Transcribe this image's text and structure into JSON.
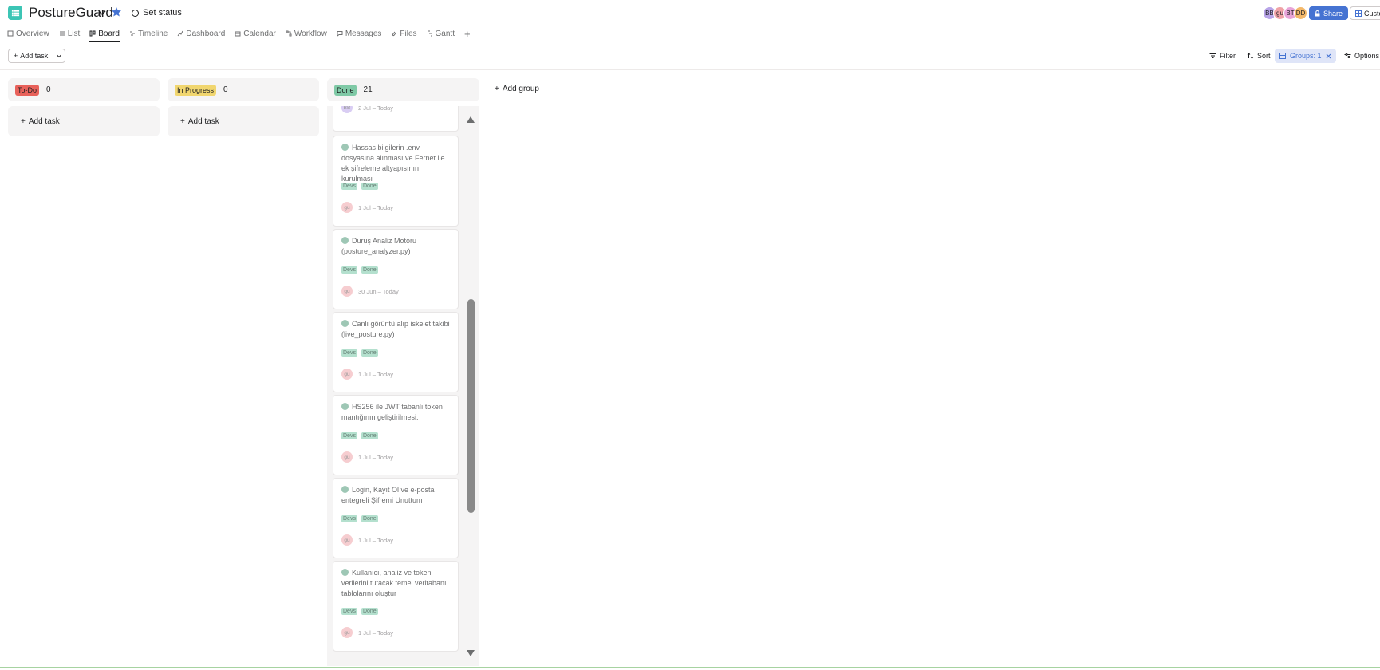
{
  "header": {
    "project_title": "PostureGuard",
    "set_status": "Set status",
    "avatars": [
      {
        "initials": "BB",
        "color": "#b8a4e8"
      },
      {
        "initials": "gu",
        "color": "#f0a2a6"
      },
      {
        "initials": "BT",
        "color": "#e8a4d8"
      },
      {
        "initials": "DD",
        "color": "#f4b96b"
      }
    ],
    "share_label": "Share",
    "customize_label": "Custom"
  },
  "tabs": [
    {
      "label": "Overview",
      "icon": "overview-icon"
    },
    {
      "label": "List",
      "icon": "list-icon"
    },
    {
      "label": "Board",
      "icon": "board-icon",
      "active": true
    },
    {
      "label": "Timeline",
      "icon": "timeline-icon"
    },
    {
      "label": "Dashboard",
      "icon": "dashboard-icon"
    },
    {
      "label": "Calendar",
      "icon": "calendar-icon"
    },
    {
      "label": "Workflow",
      "icon": "workflow-icon"
    },
    {
      "label": "Messages",
      "icon": "messages-icon"
    },
    {
      "label": "Files",
      "icon": "files-icon"
    },
    {
      "label": "Gantt",
      "icon": "gantt-icon"
    }
  ],
  "toolbar": {
    "add_task_label": "Add task",
    "filter_label": "Filter",
    "sort_label": "Sort",
    "groups_label": "Groups: 1",
    "options_label": "Options"
  },
  "columns": [
    {
      "name": "To-Do",
      "count": "0",
      "pill_color": "#e8615a",
      "add_task": "Add task"
    },
    {
      "name": "In Progress",
      "count": "0",
      "pill_color": "#f1d66f",
      "add_task": "Add task"
    },
    {
      "name": "Done",
      "count": "21",
      "pill_color": "#7fc9a6"
    }
  ],
  "cards": [
    {
      "title": "",
      "tags": [],
      "assignee": "BB",
      "assignee_color": "#c9b8ee",
      "dates": "2 Jul – Today"
    },
    {
      "title": "Hassas bilgilerin .env dosyasına alınması ve Fernet ile ek şifreleme altyapısının kurulması",
      "tags": [
        "Devs",
        "Done"
      ],
      "assignee": "gu",
      "assignee_color": "#f3b9bd",
      "dates": "1 Jul – Today"
    },
    {
      "title": "Duruş Analiz Motoru (posture_analyzer.py)",
      "tags": [
        "Devs",
        "Done"
      ],
      "assignee": "gu",
      "assignee_color": "#f3b9bd",
      "dates": "30 Jun – Today"
    },
    {
      "title": "Canlı görüntü alıp iskelet takibi (live_posture.py)",
      "tags": [
        "Devs",
        "Done"
      ],
      "assignee": "gu",
      "assignee_color": "#f3b9bd",
      "dates": "1 Jul – Today"
    },
    {
      "title": "HS256 ile JWT tabanlı token mantığının geliştirilmesi.",
      "tags": [
        "Devs",
        "Done"
      ],
      "assignee": "gu",
      "assignee_color": "#f3b9bd",
      "dates": "1 Jul – Today"
    },
    {
      "title": "Login, Kayıt Ol ve e-posta entegreli Şifremi Unuttum",
      "tags": [
        "Devs",
        "Done"
      ],
      "assignee": "gu",
      "assignee_color": "#f3b9bd",
      "dates": "1 Jul – Today"
    },
    {
      "title": "Kullanıcı, analiz ve token verilerini tutacak temel veritabanı tablolarını oluştur",
      "tags": [
        "Devs",
        "Done"
      ],
      "assignee": "gu",
      "assignee_color": "#f3b9bd",
      "dates": "1 Jul – Today"
    }
  ],
  "add_group_label": "Add group"
}
